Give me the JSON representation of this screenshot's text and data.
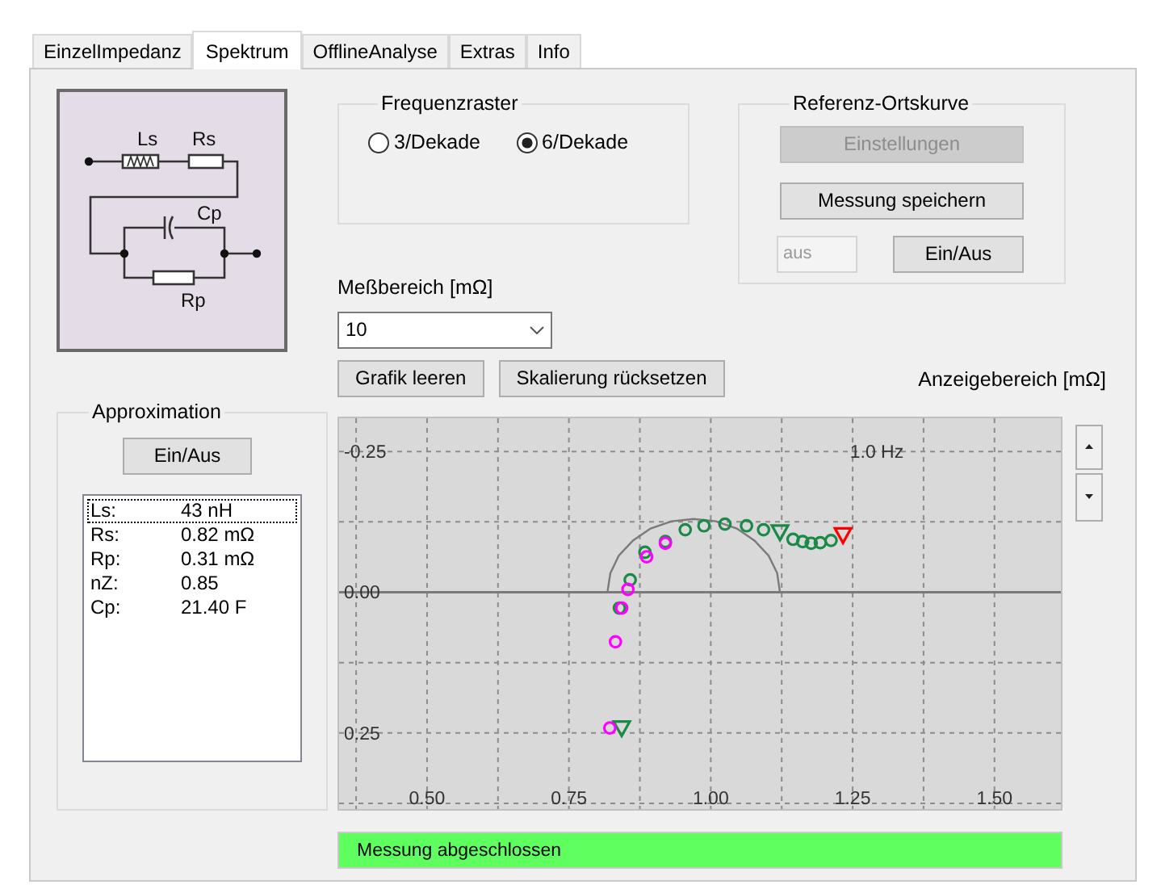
{
  "tabs": [
    {
      "label": "EinzelImpedanz",
      "selected": false
    },
    {
      "label": "Spektrum",
      "selected": true
    },
    {
      "label": "OfflineAnalyse",
      "selected": false
    },
    {
      "label": "Extras",
      "selected": false
    },
    {
      "label": "Info",
      "selected": false
    }
  ],
  "circuit": {
    "labels": [
      "Ls",
      "Rs",
      "Cp",
      "Rp"
    ]
  },
  "frequenzraster": {
    "title": "Frequenzraster",
    "options": [
      {
        "label": "3/Dekade",
        "selected": false
      },
      {
        "label": "6/Dekade",
        "selected": true
      }
    ]
  },
  "referenz_ortskurve": {
    "title": "Referenz-Ortskurve",
    "buttons": [
      {
        "label": "Einstellungen",
        "disabled": true
      },
      {
        "label": "Messung speichern",
        "disabled": false
      }
    ],
    "status_field": {
      "value": "aus",
      "disabled": true
    },
    "toggle_button": "Ein/Aus"
  },
  "messbereich": {
    "label": "Meßbereich [mΩ]",
    "value": "10"
  },
  "buttons": [
    "Grafik leeren",
    "Skalierung rücksetzen"
  ],
  "anzeigebereich_label": "Anzeigebereich [mΩ]",
  "approximation": {
    "title": "Approximation",
    "button": "Ein/Aus",
    "rows": [
      {
        "name": "Ls:",
        "value": "43 nH",
        "selected": true
      },
      {
        "name": "Rs:",
        "value": "0.82 mΩ",
        "selected": false
      },
      {
        "name": "Rp:",
        "value": "0.31 mΩ",
        "selected": false
      },
      {
        "name": "nZ:",
        "value": "0.85",
        "selected": false
      },
      {
        "name": "Cp:",
        "value": "21.40 F",
        "selected": false
      }
    ]
  },
  "chart": {
    "chart_data": {
      "type": "scatter",
      "grid": true,
      "xlim": [
        0.345,
        1.617
      ],
      "ylim": [
        0.385,
        -0.309
      ],
      "xticks": [
        {
          "value": 0.5,
          "label": "0.50"
        },
        {
          "value": 0.75,
          "label": "0.75"
        },
        {
          "value": 1.0,
          "label": "1.00"
        },
        {
          "value": 1.25,
          "label": "1.25"
        },
        {
          "value": 1.5,
          "label": "1.50"
        }
      ],
      "yticks": [
        {
          "value": -0.25,
          "label": "-0.25"
        },
        {
          "value": 0,
          "label": "0.00"
        },
        {
          "value": 0.25,
          "label": "0.25"
        }
      ],
      "series": [
        {
          "type": "line",
          "marker": "none",
          "color": "#7a7a7a",
          "x": [
            0.818,
            0.823,
            0.838,
            0.863,
            0.894,
            0.931,
            0.97,
            1.009,
            1.046,
            1.077,
            1.102,
            1.117,
            1.122
          ],
          "values": [
            0,
            -0.034,
            -0.065,
            -0.092,
            -0.113,
            -0.126,
            -0.13,
            -0.126,
            -0.113,
            -0.092,
            -0.065,
            -0.034,
            0
          ]
        },
        {
          "marker": "circle",
          "color": "#1a8a46",
          "x": [
            0.839,
            0.858,
            0.884,
            0.92,
            0.955,
            0.988,
            1.025,
            1.063,
            1.093,
            1.145,
            1.162,
            1.177,
            1.193,
            1.212
          ],
          "values": [
            0.028,
            -0.022,
            -0.071,
            -0.09,
            -0.111,
            -0.118,
            -0.121,
            -0.118,
            -0.111,
            -0.094,
            -0.09,
            -0.087,
            -0.088,
            -0.092
          ]
        },
        {
          "marker": "triangle",
          "color": "#1a8a46",
          "x": [
            1.122,
            0.843
          ],
          "values": [
            -0.107,
            0.241
          ]
        },
        {
          "marker": "triangle",
          "color": "#ff0000",
          "x": [
            1.233
          ],
          "values": [
            -0.102
          ]
        },
        {
          "marker": "circle",
          "color": "#ff00ff",
          "x": [
            0.854,
            0.843,
            0.887,
            0.92,
            0.832,
            0.822
          ],
          "values": [
            -0.005,
            0.028,
            -0.063,
            -0.087,
            0.088,
            0.241
          ]
        }
      ],
      "annotations": [
        "1.0 Hz"
      ]
    }
  },
  "status_bar": "Messung abgeschlossen"
}
